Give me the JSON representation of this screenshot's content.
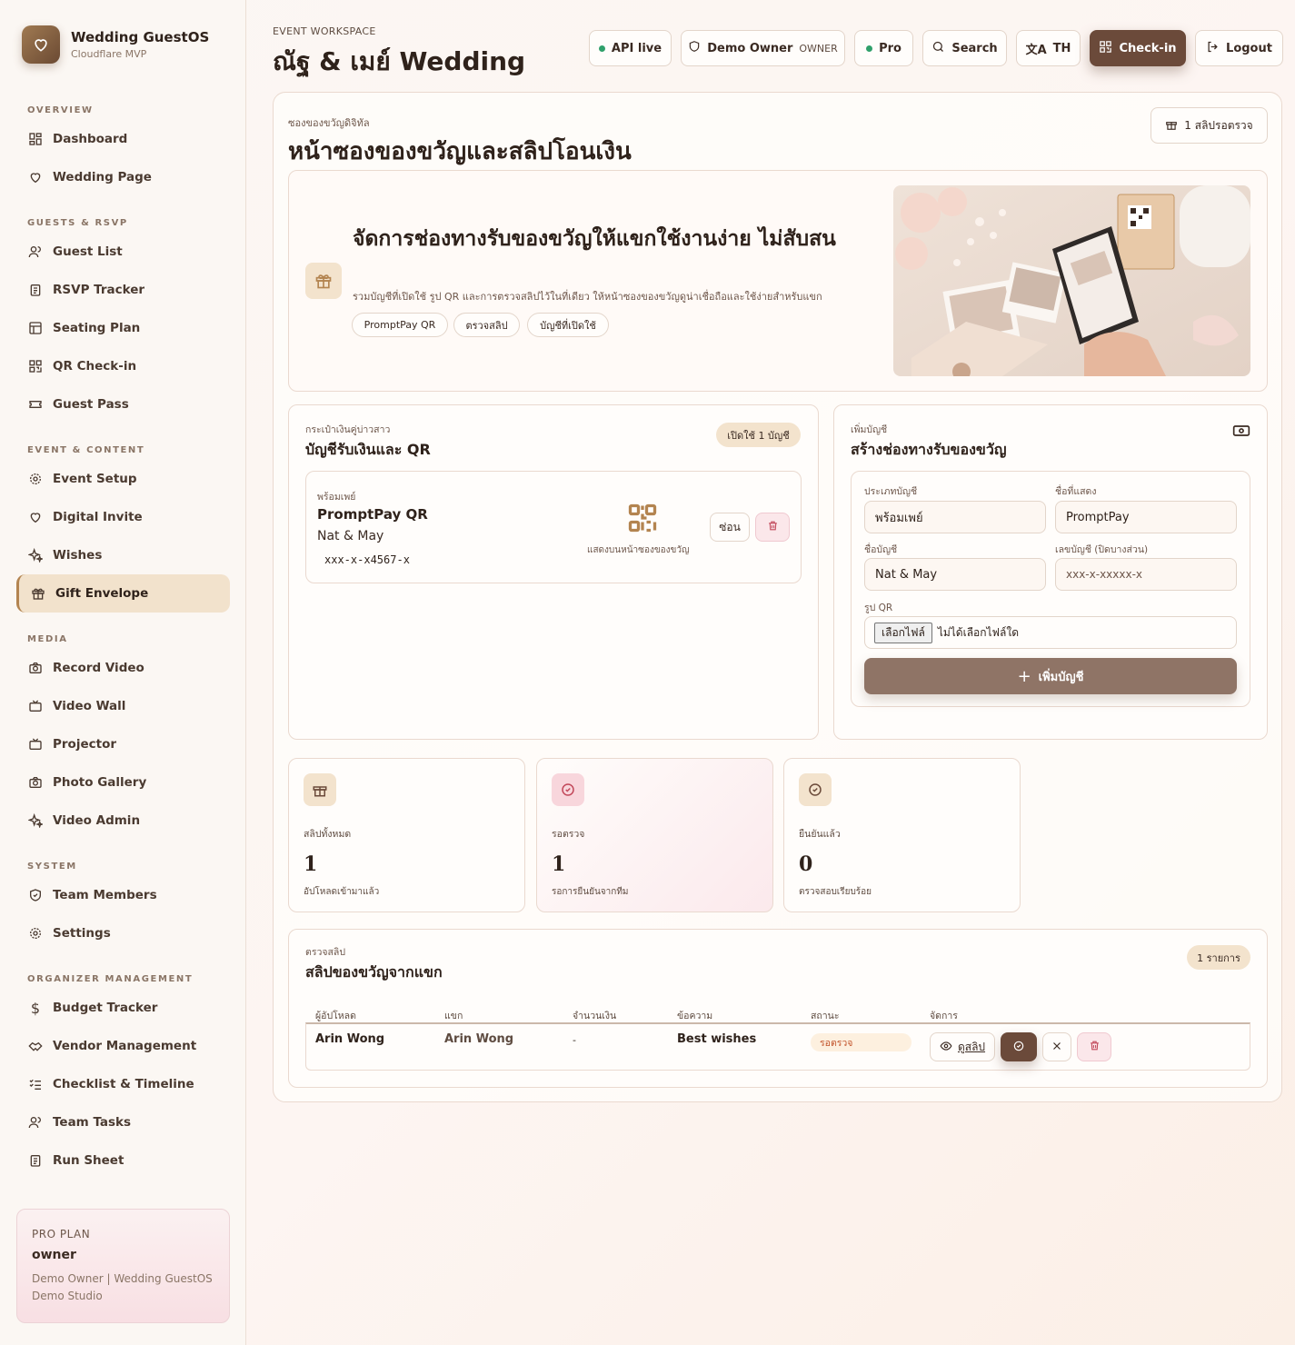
{
  "brand": {
    "title": "Wedding GuestOS",
    "subtitle": "Cloudflare MVP"
  },
  "nav": {
    "sections": [
      {
        "label": "OVERVIEW",
        "items": [
          {
            "label": "Dashboard",
            "icon": "dashboard-icon"
          },
          {
            "label": "Wedding Page",
            "icon": "heart-icon"
          }
        ]
      },
      {
        "label": "GUESTS & RSVP",
        "items": [
          {
            "label": "Guest List",
            "icon": "users-icon"
          },
          {
            "label": "RSVP Tracker",
            "icon": "clipboard-icon"
          },
          {
            "label": "Seating Plan",
            "icon": "layout-icon"
          },
          {
            "label": "QR Check-in",
            "icon": "qr-icon"
          },
          {
            "label": "Guest Pass",
            "icon": "ticket-icon"
          }
        ]
      },
      {
        "label": "EVENT & CONTENT",
        "items": [
          {
            "label": "Event Setup",
            "icon": "gear-icon"
          },
          {
            "label": "Digital Invite",
            "icon": "heart-icon"
          },
          {
            "label": "Wishes",
            "icon": "sparkles-icon"
          },
          {
            "label": "Gift Envelope",
            "icon": "gift-icon",
            "active": true
          }
        ]
      },
      {
        "label": "MEDIA",
        "items": [
          {
            "label": "Record Video",
            "icon": "camera-icon"
          },
          {
            "label": "Video Wall",
            "icon": "tv-icon"
          },
          {
            "label": "Projector",
            "icon": "tv-icon"
          },
          {
            "label": "Photo Gallery",
            "icon": "camera-icon"
          },
          {
            "label": "Video Admin",
            "icon": "sparkles-icon"
          }
        ]
      },
      {
        "label": "SYSTEM",
        "items": [
          {
            "label": "Team Members",
            "icon": "shield-icon"
          },
          {
            "label": "Settings",
            "icon": "gear-icon"
          }
        ]
      },
      {
        "label": "ORGANIZER MANAGEMENT",
        "items": [
          {
            "label": "Budget Tracker",
            "icon": "dollar-icon"
          },
          {
            "label": "Vendor Management",
            "icon": "handshake-icon"
          },
          {
            "label": "Checklist & Timeline",
            "icon": "checklist-icon"
          },
          {
            "label": "Team Tasks",
            "icon": "users-icon"
          },
          {
            "label": "Run Sheet",
            "icon": "clipboard-icon"
          }
        ]
      }
    ]
  },
  "plan": {
    "label": "PRO PLAN",
    "role": "owner",
    "line1": "Demo Owner | Wedding GuestOS",
    "line2": "Demo Studio"
  },
  "header": {
    "kicker": "EVENT WORKSPACE",
    "title": "ณัฐ & เมย์ Wedding",
    "api": "API live",
    "user": "Demo Owner",
    "user_tag": "OWNER",
    "plan": "Pro",
    "search": "Search",
    "lang": "TH",
    "checkin": "Check-in",
    "logout": "Logout"
  },
  "panel": {
    "kicker": "ซองของขวัญดิจิทัล",
    "title": "หน้าซองของขวัญและสลิปโอนเงิน",
    "pending_button": "1 สลิปรอตรวจ"
  },
  "hero": {
    "title": "จัดการช่องทางรับของขวัญให้แขกใช้งานง่าย ไม่สับสน",
    "desc": "รวมบัญชีที่เปิดใช้ รูป QR และการตรวจสลิปไว้ในที่เดียว ให้หน้าซองของขวัญดูน่าเชื่อถือและใช้ง่ายสำหรับแขก",
    "chips": [
      "PromptPay QR",
      "ตรวจสลิป",
      "บัญชีที่เปิดใช้"
    ]
  },
  "wallet": {
    "kicker": "กระเป๋าเงินคู่บ่าวสาว",
    "title": "บัญชีรับเงินและ QR",
    "badge": "เปิดใช้ 1 บัญชี",
    "account": {
      "type": "พร้อมเพย์",
      "display": "PromptPay QR",
      "name": "Nat & May",
      "number": "xxx-x-x4567-x",
      "qr_caption": "แสดงบนหน้าซองของขวัญ",
      "hide_label": "ซ่อน"
    }
  },
  "add_account": {
    "kicker": "เพิ่มบัญชี",
    "title": "สร้างช่องทางรับของขวัญ",
    "type_label": "ประเภทบัญชี",
    "type_value": "พร้อมเพย์",
    "display_label": "ชื่อที่แสดง",
    "display_value": "PromptPay",
    "name_label": "ชื่อบัญชี",
    "name_value": "Nat & May",
    "number_label": "เลขบัญชี (ปิดบางส่วน)",
    "number_placeholder": "xxx-x-xxxxx-x",
    "qr_label": "รูป QR",
    "file_button": "เลือกไฟล์",
    "file_status": "ไม่ได้เลือกไฟล์ใด",
    "submit": "เพิ่มบัญชี"
  },
  "stats": [
    {
      "label": "สลิปทั้งหมด",
      "value": "1",
      "sub": "อัปโหลดเข้ามาแล้ว"
    },
    {
      "label": "รอตรวจ",
      "value": "1",
      "sub": "รอการยืนยันจากทีม"
    },
    {
      "label": "ยืนยันแล้ว",
      "value": "0",
      "sub": "ตรวจสอบเรียบร้อย"
    }
  ],
  "slips": {
    "kicker": "ตรวจสลิป",
    "title": "สลิปของขวัญจากแขก",
    "badge": "1 รายการ",
    "columns": [
      "ผู้อัปโหลด",
      "แขก",
      "จำนวนเงิน",
      "ข้อความ",
      "สถานะ",
      "จัดการ"
    ],
    "rows": [
      {
        "uploader": "Arin Wong",
        "guest": "Arin Wong",
        "amount": "-",
        "message": "Best wishes",
        "status": "รอตรวจ",
        "view_label": "ดูสลิป"
      }
    ]
  },
  "colors": {
    "accent": "#6b4a3a",
    "active_nav": "#f2e2cc",
    "status_live": "#2fa06b",
    "pending_text": "#c2532a"
  }
}
